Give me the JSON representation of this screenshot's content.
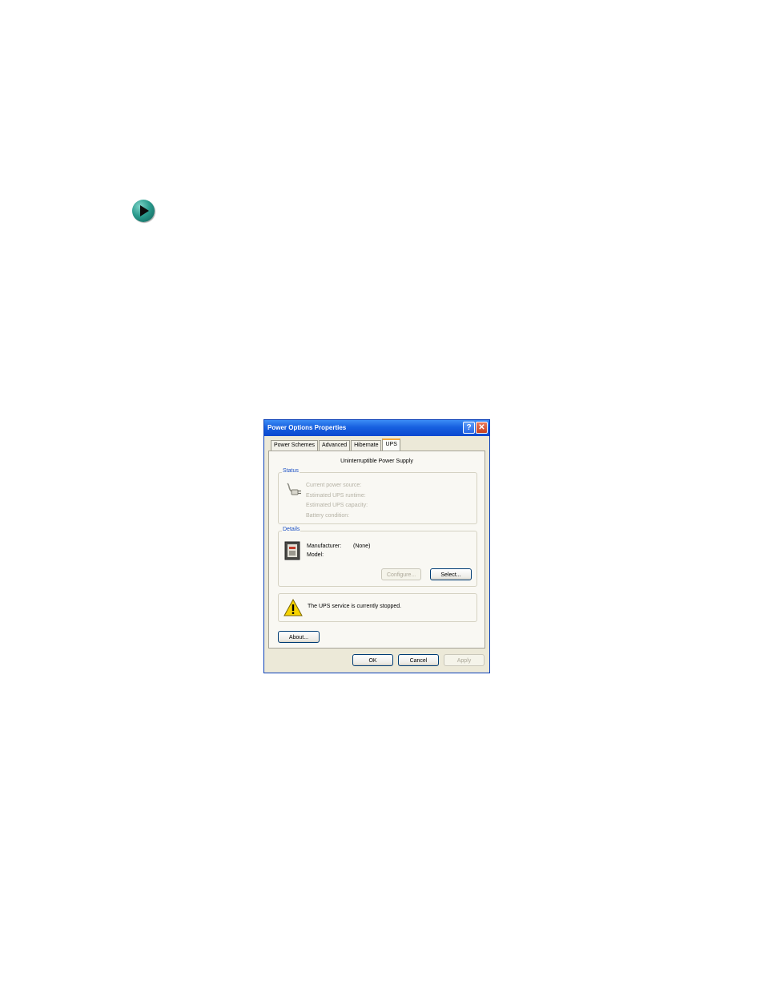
{
  "page": {
    "bullet_icon": "green-arrow-bullet-icon"
  },
  "dialog": {
    "title": "Power Options Properties",
    "help_glyph": "?",
    "close_glyph": "✕",
    "tabs": [
      {
        "label": "Power Schemes"
      },
      {
        "label": "Advanced"
      },
      {
        "label": "Hibernate"
      },
      {
        "label": "UPS",
        "active": true
      }
    ],
    "heading": "Uninterruptible Power Supply",
    "status": {
      "label": "Status",
      "icon": "power-plug-icon",
      "lines": [
        "Current power source:",
        "Estimated UPS runtime:",
        "Estimated UPS capacity:",
        "Battery condition:"
      ]
    },
    "details": {
      "label": "Details",
      "icon": "ups-device-icon",
      "manufacturer_label": "Manufacturer:",
      "manufacturer_value": "(None)",
      "model_label": "Model:",
      "configure_label": "Configure...",
      "select_label": "Select..."
    },
    "warning": {
      "icon": "warning-icon",
      "text": "The UPS service is currently stopped."
    },
    "about_label": "About...",
    "ok_label": "OK",
    "cancel_label": "Cancel",
    "apply_label": "Apply"
  }
}
